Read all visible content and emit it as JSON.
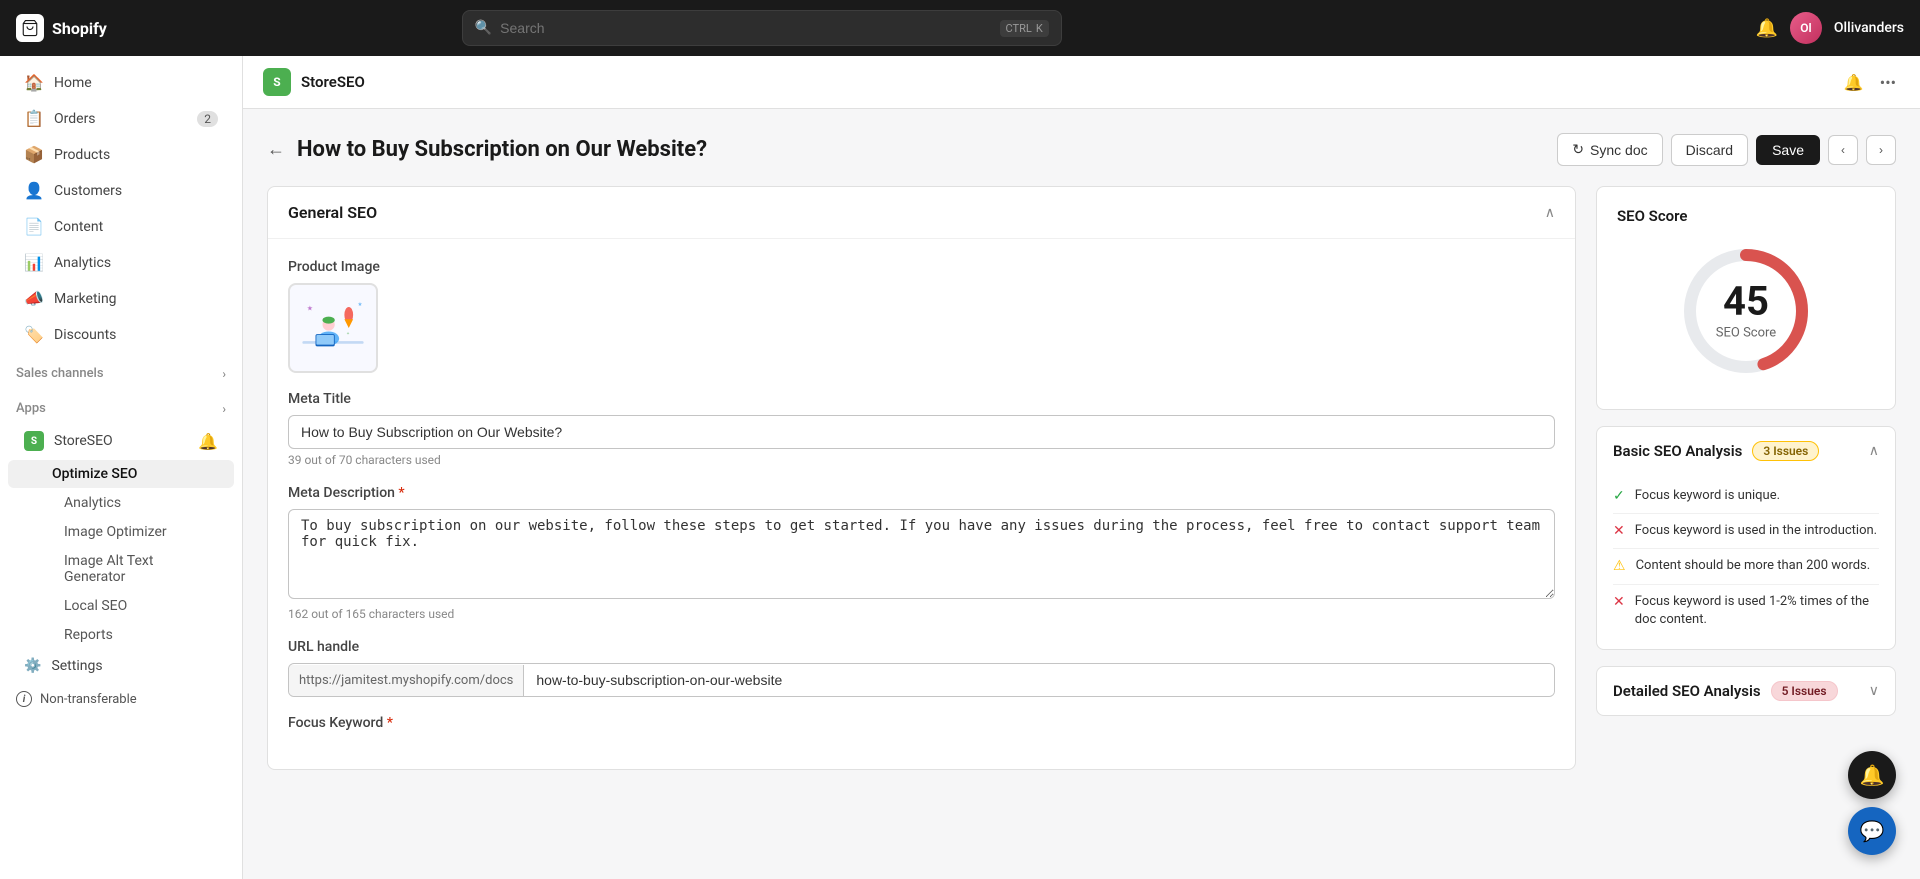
{
  "topbar": {
    "logo_text": "Shopify",
    "search_placeholder": "Search",
    "shortcut1": "CTRL",
    "shortcut2": "K",
    "store_name": "Ollivanders",
    "avatar_initials": "Ol"
  },
  "sidebar": {
    "nav_items": [
      {
        "id": "home",
        "label": "Home",
        "icon": "🏠",
        "badge": null
      },
      {
        "id": "orders",
        "label": "Orders",
        "icon": "📋",
        "badge": "2"
      },
      {
        "id": "products",
        "label": "Products",
        "icon": "📦",
        "badge": null
      },
      {
        "id": "customers",
        "label": "Customers",
        "icon": "👤",
        "badge": null
      },
      {
        "id": "content",
        "label": "Content",
        "icon": "📄",
        "badge": null
      },
      {
        "id": "analytics",
        "label": "Analytics",
        "icon": "📊",
        "badge": null
      },
      {
        "id": "marketing",
        "label": "Marketing",
        "icon": "📣",
        "badge": null
      },
      {
        "id": "discounts",
        "label": "Discounts",
        "icon": "🏷️",
        "badge": null
      }
    ],
    "sales_channels_label": "Sales channels",
    "apps_label": "Apps",
    "store_seo_label": "StoreSEO",
    "optimize_seo_label": "Optimize SEO",
    "analytics_label": "Analytics",
    "image_optimizer_label": "Image Optimizer",
    "image_alt_text_label": "Image Alt Text Generator",
    "local_seo_label": "Local SEO",
    "reports_label": "Reports",
    "settings_label": "Settings",
    "non_transferable_label": "Non-transferable"
  },
  "app_header": {
    "store_seo_title": "StoreSEO"
  },
  "page": {
    "title": "How to Buy Subscription on Our Website?",
    "back_label": "←",
    "sync_label": "Sync doc",
    "discard_label": "Discard",
    "save_label": "Save"
  },
  "general_seo": {
    "section_title": "General SEO",
    "product_image_label": "Product Image",
    "meta_title_label": "Meta Title",
    "meta_title_value": "How to Buy Subscription on Our Website?",
    "meta_title_hint": "39 out of 70 characters used",
    "meta_description_label": "Meta Description",
    "meta_description_required": "*",
    "meta_description_value": "To buy subscription on our website, follow these steps to get started. If you have any issues during the process, feel free to contact support team for quick fix.",
    "meta_description_hint": "162 out of 165 characters used",
    "url_handle_label": "URL handle",
    "url_prefix": "https://jamitest.myshopify.com/docs",
    "url_value": "how-to-buy-subscription-on-our-website",
    "focus_keyword_label": "Focus Keyword",
    "focus_keyword_required": "*"
  },
  "seo_score": {
    "title": "SEO Score",
    "score": "45",
    "score_label": "SEO Score",
    "score_value": 45,
    "max_score": 100
  },
  "basic_seo": {
    "title": "Basic SEO Analysis",
    "issues_label": "3 Issues",
    "items": [
      {
        "status": "check",
        "text": "Focus keyword is unique."
      },
      {
        "status": "cross",
        "text": "Focus keyword is used in the introduction."
      },
      {
        "status": "warn",
        "text": "Content should be more than 200 words."
      },
      {
        "status": "cross",
        "text": "Focus keyword is used 1-2% times of the doc content."
      }
    ]
  },
  "detailed_seo": {
    "title": "Detailed SEO Analysis",
    "issues_label": "5 Issues"
  }
}
